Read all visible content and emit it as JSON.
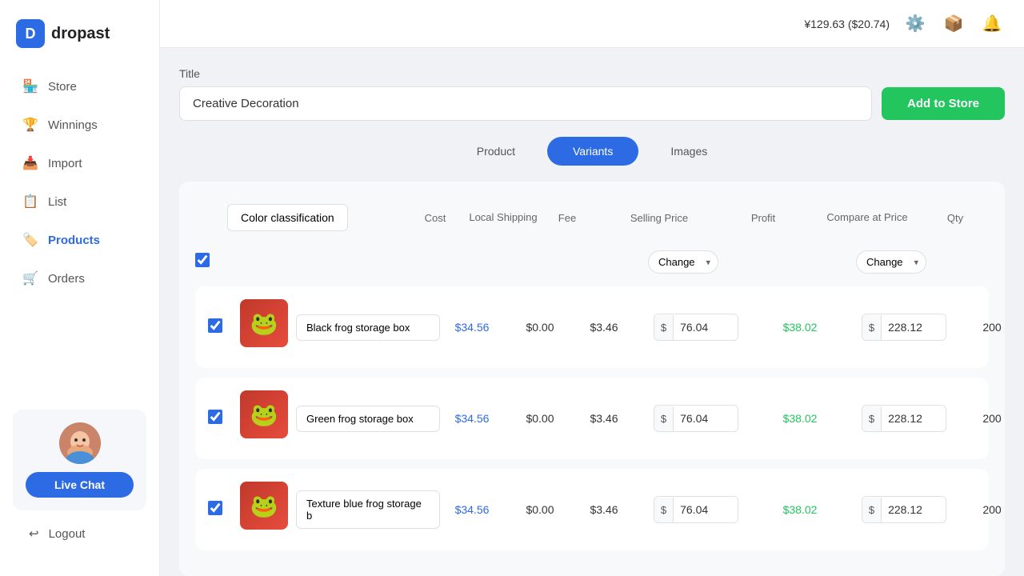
{
  "app": {
    "name": "dropast",
    "logo_letter": "D"
  },
  "topbar": {
    "balance": "¥129.63 ($20.74)"
  },
  "sidebar": {
    "nav_items": [
      {
        "id": "store",
        "label": "Store",
        "icon": "🏪"
      },
      {
        "id": "winnings",
        "label": "Winnings",
        "icon": "🏆"
      },
      {
        "id": "import",
        "label": "Import",
        "icon": "📥"
      },
      {
        "id": "list",
        "label": "List",
        "icon": "📋"
      },
      {
        "id": "products",
        "label": "Products",
        "icon": "🏷️"
      },
      {
        "id": "orders",
        "label": "Orders",
        "icon": "🛒"
      }
    ],
    "live_chat": {
      "button_label": "Live Chat"
    },
    "logout_label": "Logout"
  },
  "title_section": {
    "label": "Title",
    "value": "Creative Decoration",
    "add_to_store_label": "Add to Store"
  },
  "tabs": [
    {
      "id": "product",
      "label": "Product",
      "active": false
    },
    {
      "id": "variants",
      "label": "Variants",
      "active": true
    },
    {
      "id": "images",
      "label": "Images",
      "active": false
    }
  ],
  "table": {
    "header": {
      "classification": "Color classification",
      "cost": "Cost",
      "local_shipping": "Local Shipping",
      "fee": "Fee",
      "selling_price": "Selling Price",
      "profit": "Profit",
      "compare_at_price": "Compare at Price",
      "qty": "Qty"
    },
    "change_label": "Change",
    "rows": [
      {
        "id": "row1",
        "name": "Black frog storage box",
        "color": "black",
        "cost": "$34.56",
        "shipping": "$0.00",
        "fee": "$3.46",
        "selling_currency": "$",
        "selling_value": "76.04",
        "profit": "$38.02",
        "compare_currency": "$",
        "compare_value": "228.12",
        "qty": "200",
        "emoji": "🐸"
      },
      {
        "id": "row2",
        "name": "Green frog storage box",
        "color": "green",
        "cost": "$34.56",
        "shipping": "$0.00",
        "fee": "$3.46",
        "selling_currency": "$",
        "selling_value": "76.04",
        "profit": "$38.02",
        "compare_currency": "$",
        "compare_value": "228.12",
        "qty": "200",
        "emoji": "🐸"
      },
      {
        "id": "row3",
        "name": "Texture blue frog storage b",
        "color": "blue",
        "cost": "$34.56",
        "shipping": "$0.00",
        "fee": "$3.46",
        "selling_currency": "$",
        "selling_value": "76.04",
        "profit": "$38.02",
        "compare_currency": "$",
        "compare_value": "228.12",
        "qty": "200",
        "emoji": "🐸"
      }
    ]
  },
  "status_bar": {
    "url": "https://app.dropast.com/shopify"
  }
}
